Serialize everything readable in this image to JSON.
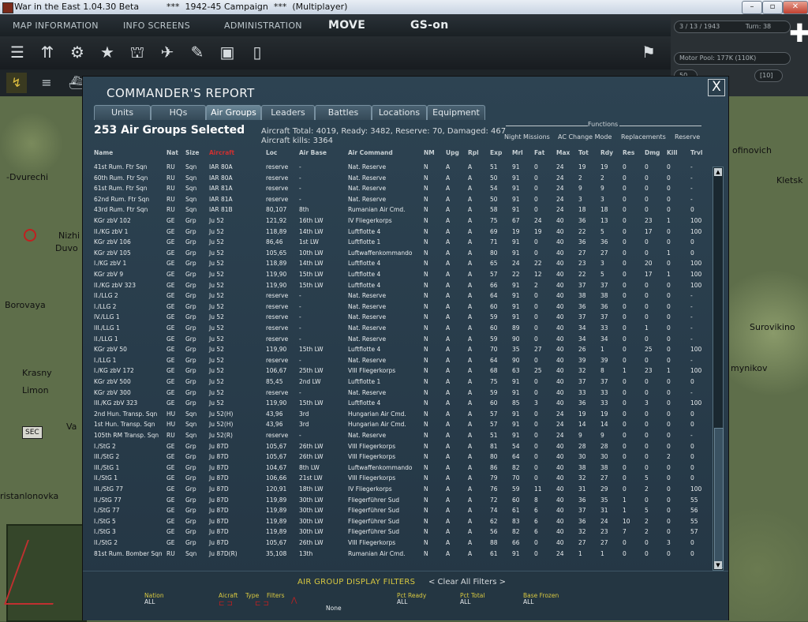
{
  "window": {
    "title": "War in the East 1.04.30 Beta          ***  1942-45 Campaign  ***  (Multiplayer)",
    "btn_min": "–",
    "btn_max": "▫",
    "btn_close": "✕"
  },
  "topnav": {
    "map_info": "MAP INFORMATION",
    "info_screens": "INFO SCREENS",
    "admin": "ADMINISTRATION",
    "move": "MOVE",
    "gs": "GS-on"
  },
  "status": {
    "date": "3 / 13 / 1943",
    "turn": "Turn: 38",
    "motor_pool": "Motor Pool: 177K (110K)",
    "counter_left": "50",
    "counter_right": "[10]"
  },
  "map_labels": {
    "l1": "-Dvurechi",
    "l2": "Nizhi",
    "l3": "Duvo",
    "l4": "Borovaya",
    "l5": "Krasny",
    "l6": "Limon",
    "l7": "ristanlonovka",
    "l8": "ofinovich",
    "l9": "Kletsk",
    "l10": "Surovikino",
    "l11": "mynikov",
    "l12": "SEC",
    "l13": "Va"
  },
  "dialog": {
    "title": "COMMANDER'S REPORT",
    "close": "X",
    "selected": "253 Air Groups Selected",
    "stats_line1": "Aircraft Total: 4019, Ready: 3482, Reserve: 70, Damaged: 467",
    "stats_line2": "Aircraft kills: 3364"
  },
  "tabs": [
    "Units",
    "HQs",
    "Air Groups",
    "Leaders",
    "Battles",
    "Locations",
    "Equipment"
  ],
  "functions": {
    "title": "Functions",
    "items": [
      "Night Missions",
      "AC Change Mode",
      "Replacements",
      "Reserve"
    ]
  },
  "columns": [
    "Name",
    "Nat",
    "Size",
    "Aircraft",
    "Loc",
    "Air Base",
    "Air Command",
    "NM",
    "Upg",
    "Rpl",
    "Exp",
    "Mrl",
    "Fat",
    "Max",
    "Tot",
    "Rdy",
    "Res",
    "Dmg",
    "Kill",
    "Trvl"
  ],
  "rows": [
    [
      "41st Rum. Ftr Sqn",
      "RU",
      "Sqn",
      "IAR 80A",
      "reserve",
      "-",
      "Nat. Reserve",
      "N",
      "A",
      "A",
      "51",
      "91",
      "0",
      "24",
      "19",
      "19",
      "0",
      "0",
      "0",
      "-"
    ],
    [
      "60th Rum. Ftr Sqn",
      "RU",
      "Sqn",
      "IAR 80A",
      "reserve",
      "-",
      "Nat. Reserve",
      "N",
      "A",
      "A",
      "50",
      "91",
      "0",
      "24",
      "2",
      "2",
      "0",
      "0",
      "0",
      "-"
    ],
    [
      "61st Rum. Ftr Sqn",
      "RU",
      "Sqn",
      "IAR 81A",
      "reserve",
      "-",
      "Nat. Reserve",
      "N",
      "A",
      "A",
      "54",
      "91",
      "0",
      "24",
      "9",
      "9",
      "0",
      "0",
      "0",
      "-"
    ],
    [
      "62nd Rum. Ftr Sqn",
      "RU",
      "Sqn",
      "IAR 81A",
      "reserve",
      "-",
      "Nat. Reserve",
      "N",
      "A",
      "A",
      "50",
      "91",
      "0",
      "24",
      "3",
      "3",
      "0",
      "0",
      "0",
      "-"
    ],
    [
      "43rd Rum. Ftr Sqn",
      "RU",
      "Sqn",
      "IAR 81B",
      "80,107",
      "8th",
      "Rumanian Air Cmd.",
      "N",
      "A",
      "A",
      "58",
      "91",
      "0",
      "24",
      "18",
      "18",
      "0",
      "0",
      "0",
      "0"
    ],
    [
      "KGr zbV 102",
      "GE",
      "Grp",
      "Ju 52",
      "121,92",
      "16th LW",
      "IV Fliegerkorps",
      "N",
      "A",
      "A",
      "75",
      "67",
      "24",
      "40",
      "36",
      "13",
      "0",
      "23",
      "1",
      "100"
    ],
    [
      "II./KG zbV 1",
      "GE",
      "Grp",
      "Ju 52",
      "118,89",
      "14th LW",
      "Luftflotte 4",
      "N",
      "A",
      "A",
      "69",
      "19",
      "19",
      "40",
      "22",
      "5",
      "0",
      "17",
      "0",
      "100"
    ],
    [
      "KGr zbV 106",
      "GE",
      "Grp",
      "Ju 52",
      "86,46",
      "1st LW",
      "Luftflotte 1",
      "N",
      "A",
      "A",
      "71",
      "91",
      "0",
      "40",
      "36",
      "36",
      "0",
      "0",
      "0",
      "0"
    ],
    [
      "KGr zbV 105",
      "GE",
      "Grp",
      "Ju 52",
      "105,65",
      "10th LW",
      "Luftwaffenkommando",
      "N",
      "A",
      "A",
      "80",
      "91",
      "0",
      "40",
      "27",
      "27",
      "0",
      "0",
      "1",
      "0"
    ],
    [
      "I./KG zbV 1",
      "GE",
      "Grp",
      "Ju 52",
      "118,89",
      "14th LW",
      "Luftflotte 4",
      "N",
      "A",
      "A",
      "65",
      "24",
      "22",
      "40",
      "23",
      "3",
      "0",
      "20",
      "0",
      "100"
    ],
    [
      "KGr zbV 9",
      "GE",
      "Grp",
      "Ju 52",
      "119,90",
      "15th LW",
      "Luftflotte 4",
      "N",
      "A",
      "A",
      "57",
      "22",
      "12",
      "40",
      "22",
      "5",
      "0",
      "17",
      "1",
      "100"
    ],
    [
      "II./KG zbV 323",
      "GE",
      "Grp",
      "Ju 52",
      "119,90",
      "15th LW",
      "Luftflotte 4",
      "N",
      "A",
      "A",
      "66",
      "91",
      "2",
      "40",
      "37",
      "37",
      "0",
      "0",
      "0",
      "100"
    ],
    [
      "II./LLG 2",
      "GE",
      "Grp",
      "Ju 52",
      "reserve",
      "-",
      "Nat. Reserve",
      "N",
      "A",
      "A",
      "64",
      "91",
      "0",
      "40",
      "38",
      "38",
      "0",
      "0",
      "0",
      "-"
    ],
    [
      "I./LLG 2",
      "GE",
      "Grp",
      "Ju 52",
      "reserve",
      "-",
      "Nat. Reserve",
      "N",
      "A",
      "A",
      "60",
      "91",
      "0",
      "40",
      "36",
      "36",
      "0",
      "0",
      "0",
      "-"
    ],
    [
      "IV./LLG 1",
      "GE",
      "Grp",
      "Ju 52",
      "reserve",
      "-",
      "Nat. Reserve",
      "N",
      "A",
      "A",
      "59",
      "91",
      "0",
      "40",
      "37",
      "37",
      "0",
      "0",
      "0",
      "-"
    ],
    [
      "III./LLG 1",
      "GE",
      "Grp",
      "Ju 52",
      "reserve",
      "-",
      "Nat. Reserve",
      "N",
      "A",
      "A",
      "60",
      "89",
      "0",
      "40",
      "34",
      "33",
      "0",
      "1",
      "0",
      "-"
    ],
    [
      "II./LLG 1",
      "GE",
      "Grp",
      "Ju 52",
      "reserve",
      "-",
      "Nat. Reserve",
      "N",
      "A",
      "A",
      "59",
      "90",
      "0",
      "40",
      "34",
      "34",
      "0",
      "0",
      "0",
      "-"
    ],
    [
      "KGr zbV 50",
      "GE",
      "Grp",
      "Ju 52",
      "119,90",
      "15th LW",
      "Luftflotte 4",
      "N",
      "A",
      "A",
      "70",
      "35",
      "27",
      "40",
      "26",
      "1",
      "0",
      "25",
      "0",
      "100"
    ],
    [
      "I./LLG 1",
      "GE",
      "Grp",
      "Ju 52",
      "reserve",
      "-",
      "Nat. Reserve",
      "N",
      "A",
      "A",
      "64",
      "90",
      "0",
      "40",
      "39",
      "39",
      "0",
      "0",
      "0",
      "-"
    ],
    [
      "I./KG zbV 172",
      "GE",
      "Grp",
      "Ju 52",
      "106,67",
      "25th LW",
      "VIII Fliegerkorps",
      "N",
      "A",
      "A",
      "68",
      "63",
      "25",
      "40",
      "32",
      "8",
      "1",
      "23",
      "1",
      "100"
    ],
    [
      "KGr zbV 500",
      "GE",
      "Grp",
      "Ju 52",
      "85,45",
      "2nd LW",
      "Luftflotte 1",
      "N",
      "A",
      "A",
      "75",
      "91",
      "0",
      "40",
      "37",
      "37",
      "0",
      "0",
      "0",
      "0"
    ],
    [
      "KGr zbV 300",
      "GE",
      "Grp",
      "Ju 52",
      "reserve",
      "-",
      "Nat. Reserve",
      "N",
      "A",
      "A",
      "59",
      "91",
      "0",
      "40",
      "33",
      "33",
      "0",
      "0",
      "0",
      "-"
    ],
    [
      "III./KG zbV 323",
      "GE",
      "Grp",
      "Ju 52",
      "119,90",
      "15th LW",
      "Luftflotte 4",
      "N",
      "A",
      "A",
      "60",
      "85",
      "3",
      "40",
      "36",
      "33",
      "0",
      "3",
      "0",
      "100"
    ],
    [
      "2nd Hun. Transp. Sqn",
      "HU",
      "Sqn",
      "Ju 52(H)",
      "43,96",
      "3rd",
      "Hungarian Air Cmd.",
      "N",
      "A",
      "A",
      "57",
      "91",
      "0",
      "24",
      "19",
      "19",
      "0",
      "0",
      "0",
      "0"
    ],
    [
      "1st Hun. Transp. Sqn",
      "HU",
      "Sqn",
      "Ju 52(H)",
      "43,96",
      "3rd",
      "Hungarian Air Cmd.",
      "N",
      "A",
      "A",
      "57",
      "91",
      "0",
      "24",
      "14",
      "14",
      "0",
      "0",
      "0",
      "0"
    ],
    [
      "105th RM Transp. Sqn",
      "RU",
      "Sqn",
      "Ju 52(R)",
      "reserve",
      "-",
      "Nat. Reserve",
      "N",
      "A",
      "A",
      "51",
      "91",
      "0",
      "24",
      "9",
      "9",
      "0",
      "0",
      "0",
      "-"
    ],
    [
      "I./StG 2",
      "GE",
      "Grp",
      "Ju 87D",
      "105,67",
      "26th LW",
      "VIII Fliegerkorps",
      "N",
      "A",
      "A",
      "81",
      "54",
      "0",
      "40",
      "28",
      "28",
      "0",
      "0",
      "0",
      "0"
    ],
    [
      "III./StG 2",
      "GE",
      "Grp",
      "Ju 87D",
      "105,67",
      "26th LW",
      "VIII Fliegerkorps",
      "N",
      "A",
      "A",
      "80",
      "64",
      "0",
      "40",
      "30",
      "30",
      "0",
      "0",
      "2",
      "0"
    ],
    [
      "III./StG 1",
      "GE",
      "Grp",
      "Ju 87D",
      "104,67",
      "8th LW",
      "Luftwaffenkommando",
      "N",
      "A",
      "A",
      "86",
      "82",
      "0",
      "40",
      "38",
      "38",
      "0",
      "0",
      "0",
      "0"
    ],
    [
      "II./StG 1",
      "GE",
      "Grp",
      "Ju 87D",
      "106,66",
      "21st LW",
      "VIII Fliegerkorps",
      "N",
      "A",
      "A",
      "79",
      "70",
      "0",
      "40",
      "32",
      "27",
      "0",
      "5",
      "0",
      "0"
    ],
    [
      "III./StG 77",
      "GE",
      "Grp",
      "Ju 87D",
      "120,91",
      "18th LW",
      "IV Fliegerkorps",
      "N",
      "A",
      "A",
      "76",
      "59",
      "11",
      "40",
      "31",
      "29",
      "0",
      "2",
      "0",
      "100"
    ],
    [
      "II./StG 77",
      "GE",
      "Grp",
      "Ju 87D",
      "119,89",
      "30th LW",
      "Fliegerführer Sud",
      "N",
      "A",
      "A",
      "72",
      "60",
      "8",
      "40",
      "36",
      "35",
      "1",
      "0",
      "0",
      "55"
    ],
    [
      "I./StG 77",
      "GE",
      "Grp",
      "Ju 87D",
      "119,89",
      "30th LW",
      "Fliegerführer Sud",
      "N",
      "A",
      "A",
      "74",
      "61",
      "6",
      "40",
      "37",
      "31",
      "1",
      "5",
      "0",
      "56"
    ],
    [
      "I./StG 5",
      "GE",
      "Grp",
      "Ju 87D",
      "119,89",
      "30th LW",
      "Fliegerführer Sud",
      "N",
      "A",
      "A",
      "62",
      "83",
      "6",
      "40",
      "36",
      "24",
      "10",
      "2",
      "0",
      "55"
    ],
    [
      "I./StG 3",
      "GE",
      "Grp",
      "Ju 87D",
      "119,89",
      "30th LW",
      "Fliegerführer Sud",
      "N",
      "A",
      "A",
      "56",
      "82",
      "6",
      "40",
      "32",
      "23",
      "7",
      "2",
      "0",
      "57"
    ],
    [
      "II./StG 2",
      "GE",
      "Grp",
      "Ju 87D",
      "105,67",
      "26th LW",
      "VIII Fliegerkorps",
      "N",
      "A",
      "A",
      "88",
      "66",
      "0",
      "40",
      "27",
      "27",
      "0",
      "0",
      "3",
      "0"
    ],
    [
      "81st Rum. Bomber Sqn",
      "RU",
      "Sqn",
      "Ju 87D(R)",
      "35,108",
      "13th",
      "Rumanian Air Cmd.",
      "N",
      "A",
      "A",
      "61",
      "91",
      "0",
      "24",
      "1",
      "1",
      "0",
      "0",
      "0",
      "0"
    ]
  ],
  "filters": {
    "title": "AIR GROUP DISPLAY FILTERS",
    "clear": "< Clear All Filters >",
    "nation_label": "Nation",
    "nation_value": "ALL",
    "aircraft_label": "Aicraft",
    "type_label": "Type",
    "filters_label": "Filters",
    "none_value": "None",
    "pct_ready_label": "Pct Ready",
    "pct_ready_value": "ALL",
    "pct_total_label": "Pct Total",
    "pct_total_value": "ALL",
    "base_frozen_label": "Base Frozen",
    "base_frozen_value": "ALL"
  },
  "colors": {
    "dialog_bg": "#2a3e4c",
    "header_red": "#d03030",
    "filter_yellow": "#d8c840"
  }
}
